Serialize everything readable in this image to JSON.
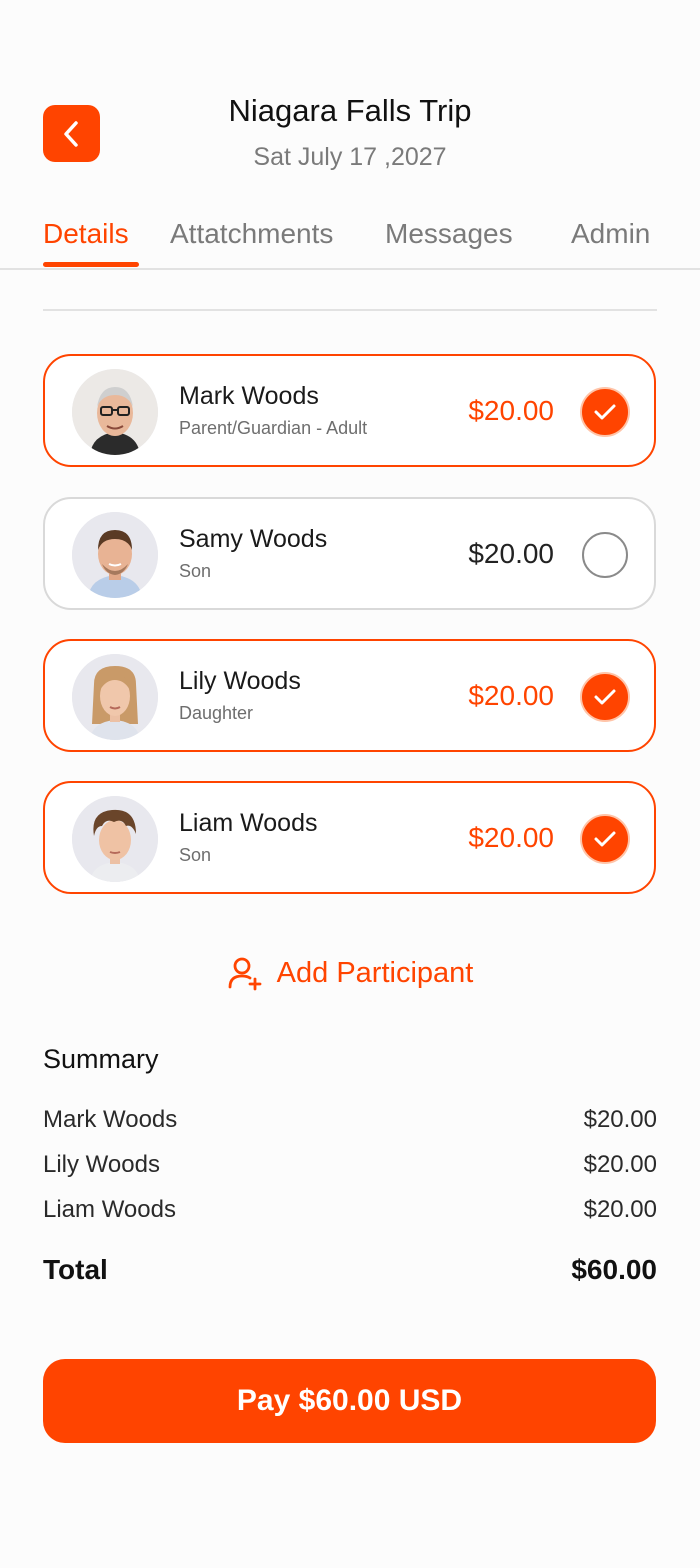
{
  "header": {
    "title": "Niagara Falls Trip",
    "date": "Sat July 17 ,2027",
    "back_icon": "chevron-left-icon",
    "accent_color": "#ff4400"
  },
  "tabs": [
    {
      "label": "Details",
      "active": true
    },
    {
      "label": "Attatchments",
      "active": false
    },
    {
      "label": "Messages",
      "active": false
    },
    {
      "label": "Admin",
      "active": false
    }
  ],
  "participants": [
    {
      "name": "Mark Woods",
      "role": "Parent/Guardian - Adult",
      "price": "$20.00",
      "selected": true
    },
    {
      "name": "Samy Woods",
      "role": "Son",
      "price": "$20.00",
      "selected": false
    },
    {
      "name": "Lily Woods",
      "role": "Daughter",
      "price": "$20.00",
      "selected": true
    },
    {
      "name": "Liam Woods",
      "role": "Son",
      "price": "$20.00",
      "selected": true
    }
  ],
  "add_participant": {
    "label": "Add Participant",
    "icon": "add-user-icon"
  },
  "summary": {
    "title": "Summary",
    "rows": [
      {
        "name": "Mark Woods",
        "amount": "$20.00"
      },
      {
        "name": "Lily Woods",
        "amount": "$20.00"
      },
      {
        "name": "Liam Woods",
        "amount": "$20.00"
      }
    ],
    "total_label": "Total",
    "total_amount": "$60.00"
  },
  "pay_button": {
    "label": "Pay $60.00 USD"
  }
}
